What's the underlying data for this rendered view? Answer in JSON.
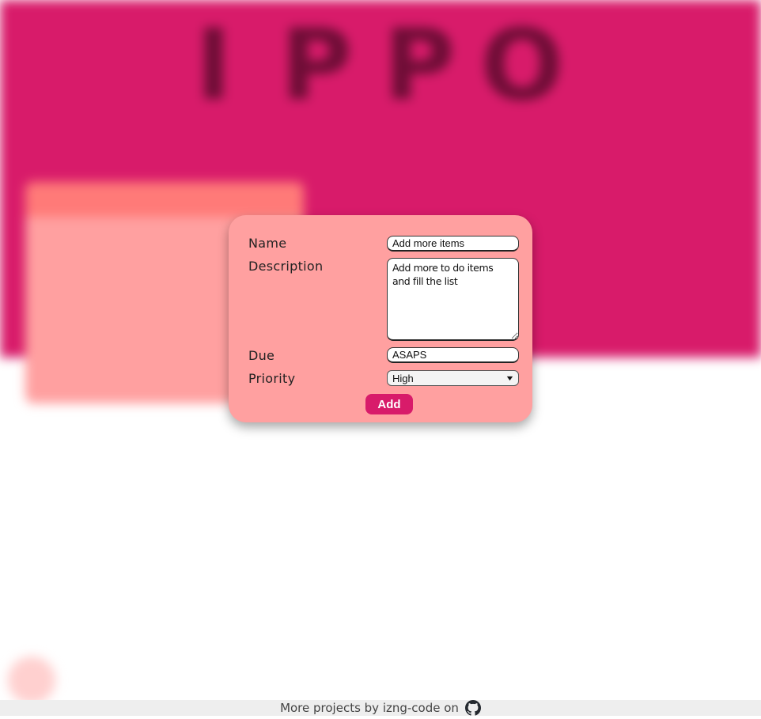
{
  "app": {
    "logo_letters": [
      "I",
      "P",
      "P",
      "O"
    ],
    "colors": {
      "hero": "#d81b6a",
      "card": "#ffa0a0",
      "card_header": "#ff7a78",
      "accent_button": "#d81b6a"
    }
  },
  "form": {
    "name_label": "Name",
    "name_value": "Add more items",
    "description_label": "Description",
    "description_value": "Add more to do items and fill the list",
    "due_label": "Due",
    "due_value": "ASAPS",
    "priority_label": "Priority",
    "priority_value": "High",
    "add_label": "Add"
  },
  "footer": {
    "text": "More projects by izng-code on",
    "icon": "github-icon"
  }
}
